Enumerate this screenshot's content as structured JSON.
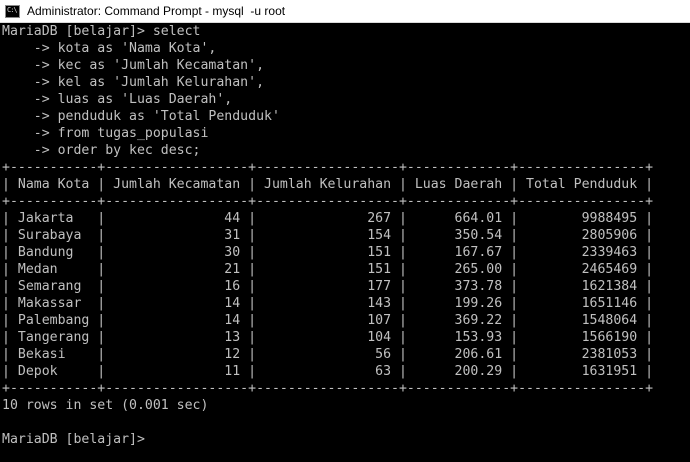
{
  "window": {
    "title": "Administrator: Command Prompt - mysql  -u root",
    "icon": "command-prompt-icon"
  },
  "console": {
    "text_color": "#c0c0c0",
    "background": "#000000",
    "lines": [
      "MariaDB [belajar]> select",
      "    -> kota as 'Nama Kota',",
      "    -> kec as 'Jumlah Kecamatan',",
      "    -> kel as 'Jumlah Kelurahan',",
      "    -> luas as 'Luas Daerah',",
      "    -> penduduk as 'Total Penduduk'",
      "    -> from tugas_populasi",
      "    -> order by kec desc;",
      "+-----------+------------------+------------------+-------------+----------------+",
      "| Nama Kota | Jumlah Kecamatan | Jumlah Kelurahan | Luas Daerah | Total Penduduk |",
      "+-----------+------------------+------------------+-------------+----------------+",
      "| Jakarta   |               44 |              267 |      664.01 |        9988495 |",
      "| Surabaya  |               31 |              154 |      350.54 |        2805906 |",
      "| Bandung   |               30 |              151 |      167.67 |        2339463 |",
      "| Medan     |               21 |              151 |      265.00 |        2465469 |",
      "| Semarang  |               16 |              177 |      373.78 |        1621384 |",
      "| Makassar  |               14 |              143 |      199.26 |        1651146 |",
      "| Palembang |               14 |              107 |      369.22 |        1548064 |",
      "| Tangerang |               13 |              104 |      153.93 |        1566190 |",
      "| Bekasi    |               12 |               56 |      206.61 |        2381053 |",
      "| Depok     |               11 |               63 |      200.29 |        1631951 |",
      "+-----------+------------------+------------------+-------------+----------------+",
      "10 rows in set (0.001 sec)",
      "",
      "MariaDB [belajar]>"
    ]
  }
}
